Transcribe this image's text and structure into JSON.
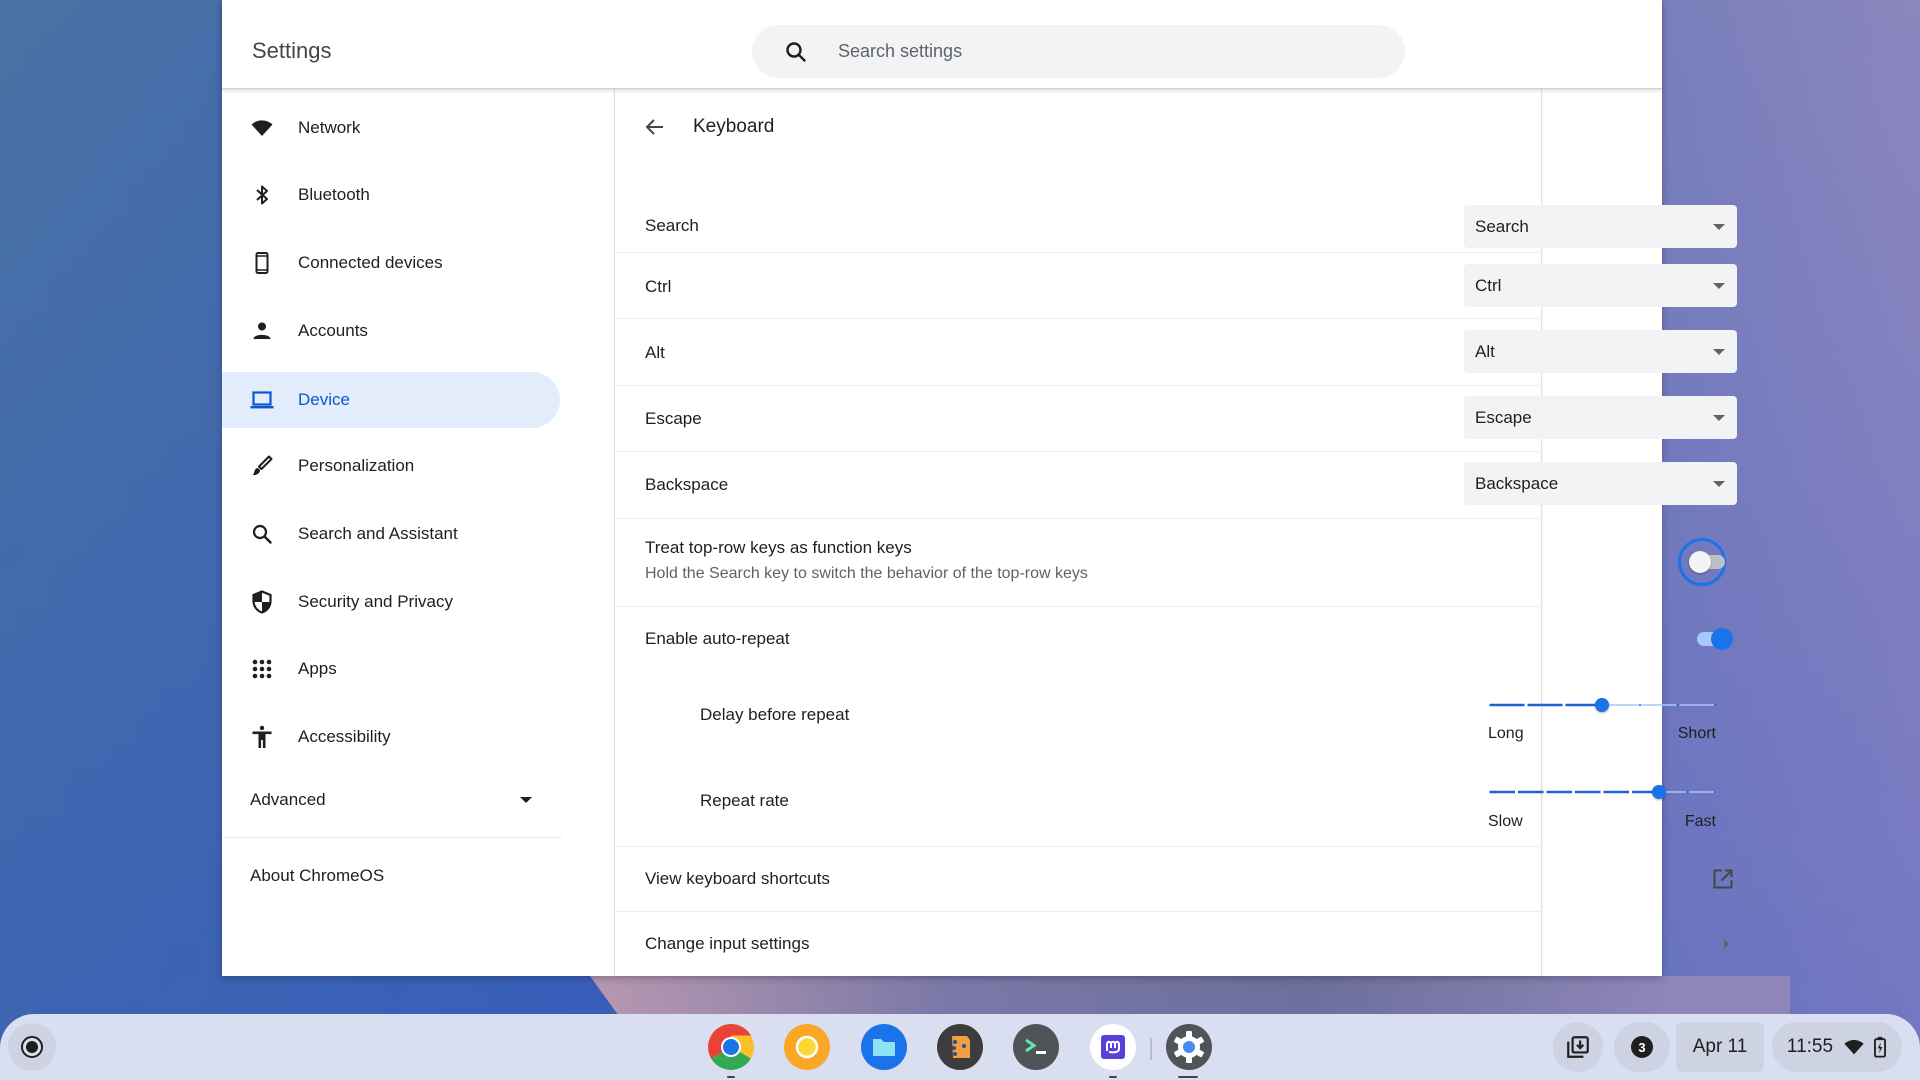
{
  "window": {
    "title": "Settings",
    "search": {
      "placeholder": "Search settings",
      "value": ""
    }
  },
  "sidebar": {
    "items": [
      {
        "label": "Network",
        "icon": "wifi-icon",
        "selected": false
      },
      {
        "label": "Bluetooth",
        "icon": "bluetooth-icon",
        "selected": false
      },
      {
        "label": "Connected devices",
        "icon": "phone-icon",
        "selected": false
      },
      {
        "label": "Accounts",
        "icon": "person-icon",
        "selected": false
      },
      {
        "label": "Device",
        "icon": "laptop-icon",
        "selected": true
      },
      {
        "label": "Personalization",
        "icon": "brush-icon",
        "selected": false
      },
      {
        "label": "Search and Assistant",
        "icon": "search-icon",
        "selected": false
      },
      {
        "label": "Security and Privacy",
        "icon": "shield-icon",
        "selected": false
      },
      {
        "label": "Apps",
        "icon": "apps-grid-icon",
        "selected": false
      },
      {
        "label": "Accessibility",
        "icon": "accessibility-icon",
        "selected": false
      }
    ],
    "advanced_label": "Advanced",
    "about_label": "About ChromeOS"
  },
  "page": {
    "title": "Keyboard",
    "key_remaps": [
      {
        "label": "Search",
        "value": "Search"
      },
      {
        "label": "Ctrl",
        "value": "Ctrl"
      },
      {
        "label": "Alt",
        "value": "Alt"
      },
      {
        "label": "Escape",
        "value": "Escape"
      },
      {
        "label": "Backspace",
        "value": "Backspace"
      }
    ],
    "function_keys": {
      "label": "Treat top-row keys as function keys",
      "sublabel": "Hold the Search key to switch the behavior of the top-row keys",
      "enabled": false
    },
    "auto_repeat": {
      "label": "Enable auto-repeat",
      "enabled": true
    },
    "delay_slider": {
      "label": "Delay before repeat",
      "min_label": "Long",
      "max_label": "Short",
      "steps": 7,
      "value_index": 3
    },
    "rate_slider": {
      "label": "Repeat rate",
      "min_label": "Slow",
      "max_label": "Fast",
      "steps": 9,
      "value_index": 6
    },
    "shortcuts_label": "View keyboard shortcuts",
    "input_settings_label": "Change input settings"
  },
  "shelf": {
    "apps": [
      {
        "name": "Chrome",
        "running": true
      },
      {
        "name": "Chrome Canary",
        "running": false
      },
      {
        "name": "Files",
        "running": false
      },
      {
        "name": "Hand app",
        "running": false
      },
      {
        "name": "Terminal",
        "running": false
      },
      {
        "name": "Mastodon",
        "running": true
      },
      {
        "name": "Settings",
        "running": true,
        "active": true
      }
    ],
    "notification_count": "3",
    "date": "Apr 11",
    "time": "11:55"
  },
  "colors": {
    "accent": "#1a73e8",
    "selected_bg": "#e3ecfb",
    "selected_text": "#0b57d0"
  }
}
